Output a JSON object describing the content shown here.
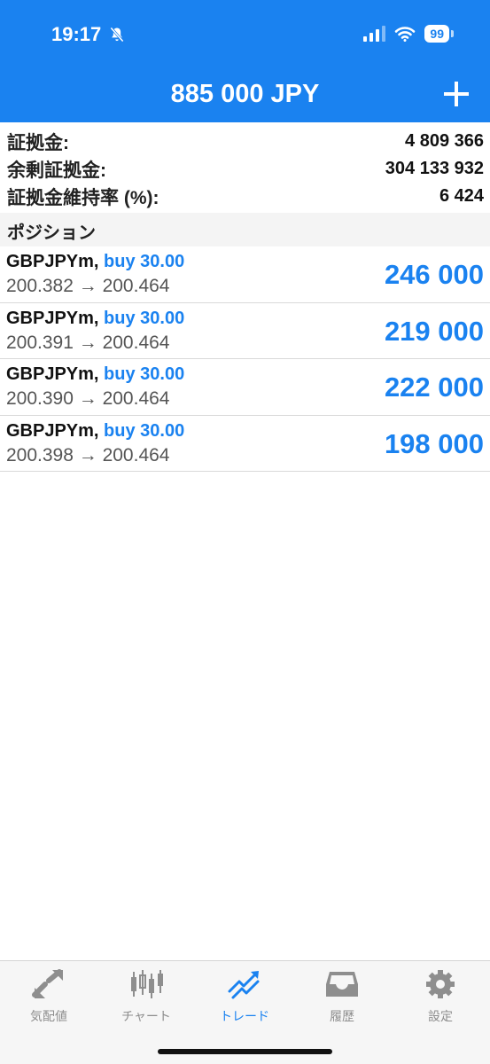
{
  "status_bar": {
    "time": "19:17",
    "battery": "99",
    "icons": [
      "bell-slash-icon",
      "signal-icon",
      "wifi-icon",
      "battery-icon"
    ]
  },
  "header": {
    "title": "885 000 JPY",
    "add_icon": "plus-icon"
  },
  "summary": [
    {
      "label": "証拠金:",
      "value": "4 809 366"
    },
    {
      "label": "余剰証拠金:",
      "value": "304 133 932"
    },
    {
      "label": "証拠金維持率 (%):",
      "value": "6 424"
    }
  ],
  "positions_header": "ポジション",
  "positions": [
    {
      "symbol": "GBPJPYm,",
      "side": "buy 30.00",
      "prices": "200.382 → 200.464",
      "profit": "246 000"
    },
    {
      "symbol": "GBPJPYm,",
      "side": "buy 30.00",
      "prices": "200.391 → 200.464",
      "profit": "219 000"
    },
    {
      "symbol": "GBPJPYm,",
      "side": "buy 30.00",
      "prices": "200.390 → 200.464",
      "profit": "222 000"
    },
    {
      "symbol": "GBPJPYm,",
      "side": "buy 30.00",
      "prices": "200.398 → 200.464",
      "profit": "198 000"
    }
  ],
  "tabs": [
    {
      "label": "気配値",
      "icon": "quotes-icon",
      "active": false
    },
    {
      "label": "チャート",
      "icon": "chart-icon",
      "active": false
    },
    {
      "label": "トレード",
      "icon": "trade-icon",
      "active": true
    },
    {
      "label": "履歴",
      "icon": "history-icon",
      "active": false
    },
    {
      "label": "設定",
      "icon": "settings-icon",
      "active": false
    }
  ],
  "colors": {
    "accent": "#1a82f0",
    "inactive_tab": "#8e8e8e",
    "separator": "#d9d9d9"
  }
}
